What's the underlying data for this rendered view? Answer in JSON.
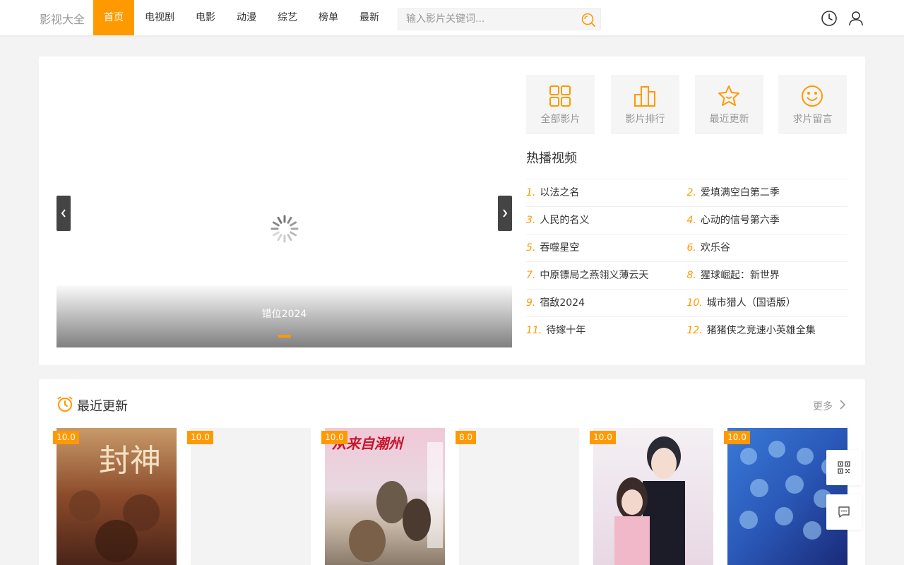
{
  "header": {
    "logo": "影视大全",
    "nav": [
      "首页",
      "电视剧",
      "电影",
      "动漫",
      "综艺",
      "榜单",
      "最新"
    ],
    "search_placeholder": "输入影片关键词...",
    "icons": [
      "search-icon",
      "history-clock-icon",
      "user-icon"
    ]
  },
  "banner": {
    "slide_title": "错位2024"
  },
  "quick_links": [
    {
      "label": "全部影片",
      "icon": "grid-icon"
    },
    {
      "label": "影片排行",
      "icon": "bar-chart-icon"
    },
    {
      "label": "最近更新",
      "icon": "star-icon"
    },
    {
      "label": "求片留言",
      "icon": "smile-icon"
    }
  ],
  "hot": {
    "title": "热播视频",
    "items": [
      {
        "num": "1.",
        "name": "以法之名"
      },
      {
        "num": "2.",
        "name": "爱填满空白第二季"
      },
      {
        "num": "3.",
        "name": "人民的名义"
      },
      {
        "num": "4.",
        "name": "心动的信号第六季"
      },
      {
        "num": "5.",
        "name": "吞噬星空"
      },
      {
        "num": "6.",
        "name": "欢乐谷"
      },
      {
        "num": "7.",
        "name": "中原镖局之燕翎义薄云天"
      },
      {
        "num": "8.",
        "name": "猩球崛起：新世界"
      },
      {
        "num": "9.",
        "name": "宿敌2024"
      },
      {
        "num": "10.",
        "name": "城市猎人（国语版）"
      },
      {
        "num": "11.",
        "name": "待嫁十年"
      },
      {
        "num": "12.",
        "name": "猪猪侠之竞速小英雄全集"
      }
    ]
  },
  "recent": {
    "title": "最近更新",
    "more": "更多",
    "cards": [
      {
        "score": "10.0",
        "poster_text": "封神"
      },
      {
        "score": "10.0",
        "poster_text": ""
      },
      {
        "score": "10.0",
        "poster_text": "从来自潮州"
      },
      {
        "score": "8.0",
        "poster_text": ""
      },
      {
        "score": "10.0",
        "poster_text": ""
      },
      {
        "score": "10.0",
        "poster_text": ""
      }
    ]
  },
  "colors": {
    "accent": "#ff9900",
    "background": "#f3f3f3"
  }
}
